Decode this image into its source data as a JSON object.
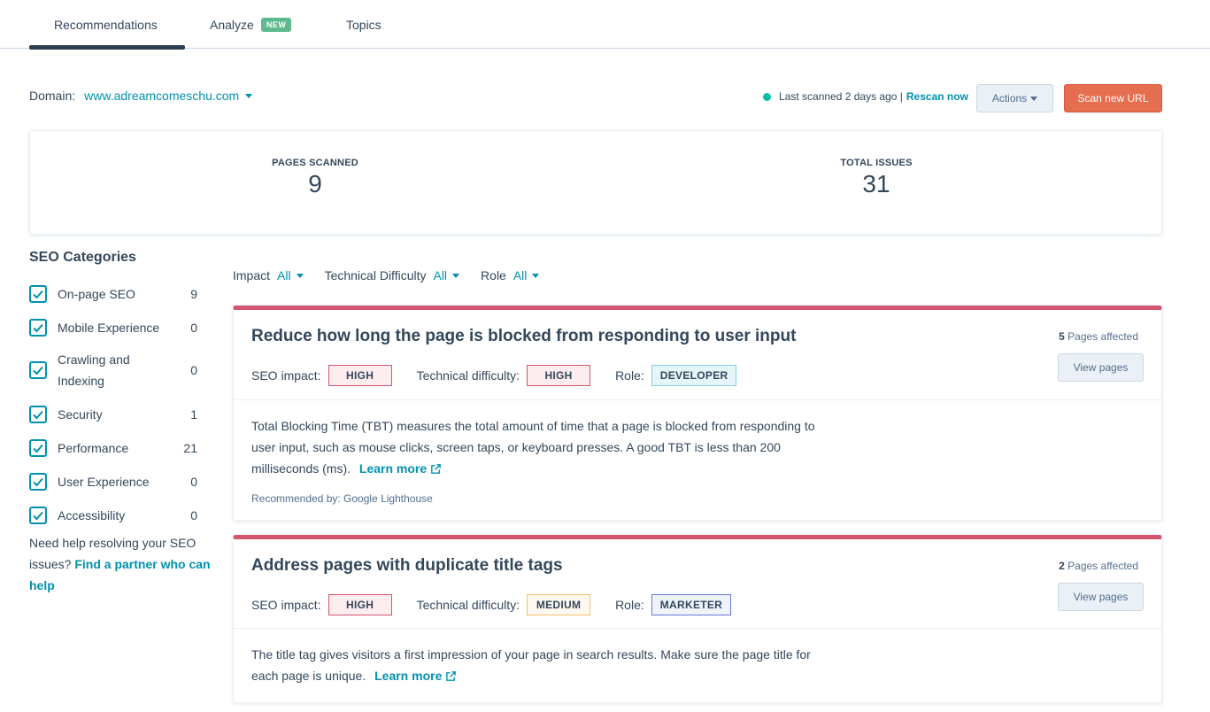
{
  "tabs": [
    {
      "label": "Recommendations"
    },
    {
      "label": "Analyze",
      "badge": "NEW"
    },
    {
      "label": "Topics"
    }
  ],
  "domain": {
    "label": "Domain:",
    "value": "www.adreamcomeschu.com"
  },
  "scan_status": {
    "text": "Last scanned 2 days ago |",
    "rescan": "Rescan now"
  },
  "buttons": {
    "actions": "Actions",
    "scan_new": "Scan new URL"
  },
  "summary": {
    "pages_label": "PAGES SCANNED",
    "pages_value": "9",
    "issues_label": "TOTAL ISSUES",
    "issues_value": "31"
  },
  "sidebar": {
    "title": "SEO Categories",
    "categories": [
      {
        "label": "On-page SEO",
        "count": "9"
      },
      {
        "label": "Mobile Experience",
        "count": "0"
      },
      {
        "label": "Crawling and Indexing",
        "count": "0"
      },
      {
        "label": "Security",
        "count": "1"
      },
      {
        "label": "Performance",
        "count": "21"
      },
      {
        "label": "User Experience",
        "count": "0"
      },
      {
        "label": "Accessibility",
        "count": "0"
      }
    ],
    "help_text": "Need help resolving your SEO issues?",
    "help_link": "Find a partner who can help"
  },
  "filters": {
    "impact_label": "Impact",
    "impact_value": "All",
    "difficulty_label": "Technical Difficulty",
    "difficulty_value": "All",
    "role_label": "Role",
    "role_value": "All"
  },
  "issues": [
    {
      "title": "Reduce how long the page is blocked from responding to user input",
      "pages_count": "5",
      "pages_label": "Pages affected",
      "view_label": "View pages",
      "impact_label": "SEO impact:",
      "impact": "HIGH",
      "difficulty_label": "Technical difficulty:",
      "difficulty": "HIGH",
      "role_label": "Role:",
      "role": "DEVELOPER",
      "description": "Total Blocking Time (TBT) measures the total amount of time that a page is blocked from responding to user input, such as mouse clicks, screen taps, or keyboard presses. A good TBT is less than 200 milliseconds (ms).",
      "learn_more": "Learn more",
      "recommended_by": "Recommended by: Google Lighthouse"
    },
    {
      "title": "Address pages with duplicate title tags",
      "pages_count": "2",
      "pages_label": "Pages affected",
      "view_label": "View pages",
      "impact_label": "SEO impact:",
      "impact": "HIGH",
      "difficulty_label": "Technical difficulty:",
      "difficulty": "MEDIUM",
      "role_label": "Role:",
      "role": "MARKETER",
      "description": "The title tag gives visitors a first impression of your page in search results. Make sure the page title for each page is unique.",
      "learn_more": "Learn more"
    }
  ],
  "colors": {
    "accent": "#0091ae",
    "primary_button": "#e66e50",
    "issue_border": "#d2566f",
    "status_dot": "#00bda5"
  }
}
